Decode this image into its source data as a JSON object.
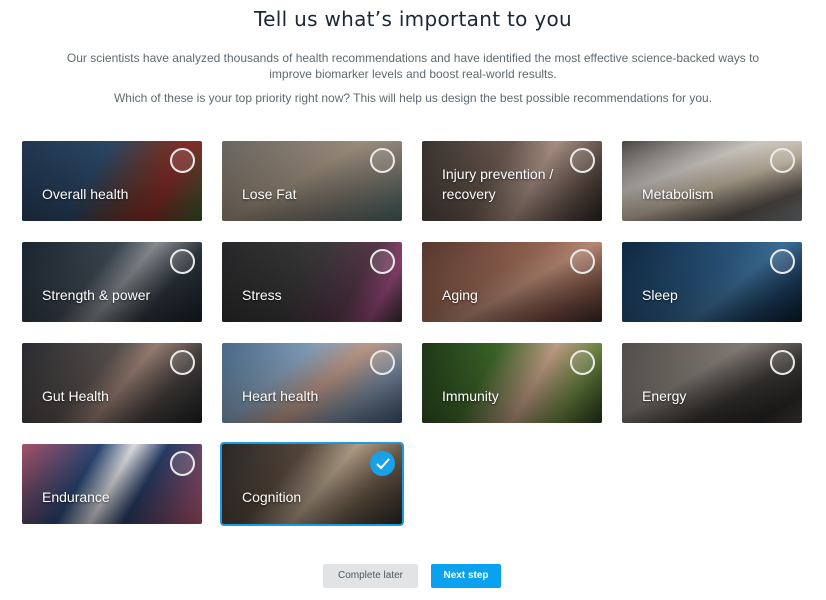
{
  "header": {
    "title": "Tell us what’s important to you",
    "description": "Our scientists have analyzed thousands of health recommendations and have identified the most effective science-backed ways to improve biomarker levels and boost real-world results.",
    "question": "Which of these is your top priority right now? This will help us design the best possible recommendations for you."
  },
  "options": [
    {
      "label": "Overall health",
      "selected": false
    },
    {
      "label": "Lose Fat",
      "selected": false
    },
    {
      "label": "Injury prevention / recovery",
      "selected": false
    },
    {
      "label": "Metabolism",
      "selected": false
    },
    {
      "label": "Strength & power",
      "selected": false
    },
    {
      "label": "Stress",
      "selected": false
    },
    {
      "label": "Aging",
      "selected": false
    },
    {
      "label": "Sleep",
      "selected": false
    },
    {
      "label": "Gut Health",
      "selected": false
    },
    {
      "label": "Heart health",
      "selected": false
    },
    {
      "label": "Immunity",
      "selected": false
    },
    {
      "label": "Energy",
      "selected": false
    },
    {
      "label": "Endurance",
      "selected": false
    },
    {
      "label": "Cognition",
      "selected": true
    }
  ],
  "buttons": {
    "complete_later": "Complete later",
    "next_step": "Next step"
  },
  "colors": {
    "accent": "#0aa2ee",
    "selected_outline": "#1d9be0",
    "secondary_button": "#e1e3e5"
  }
}
